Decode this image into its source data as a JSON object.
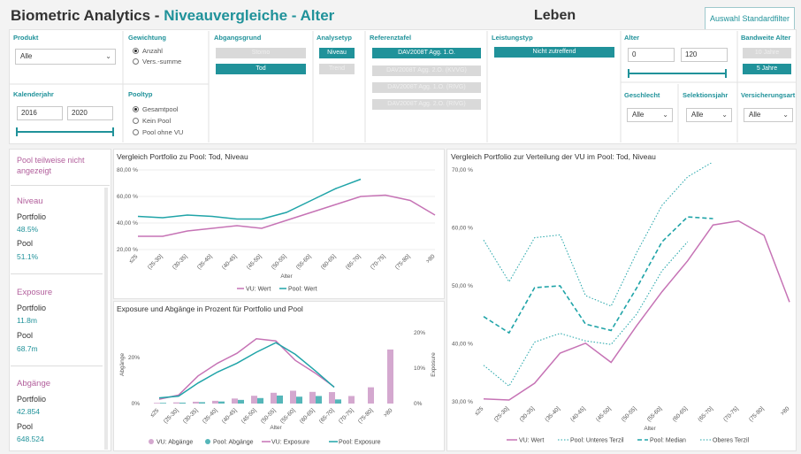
{
  "header": {
    "title_main": "Biometric Analytics - ",
    "title_accent": "Niveauvergleiche - Alter",
    "section": "Leben",
    "default_filter_button": "Auswahl Standardfilter"
  },
  "filters": {
    "produkt": {
      "label": "Produkt",
      "value": "Alle"
    },
    "gewichtung": {
      "label": "Gewichtung",
      "options": [
        "Anzahl",
        "Vers.-summe"
      ],
      "selected": "Anzahl"
    },
    "abgangsgrund": {
      "label": "Abgangsgrund",
      "buttons": [
        "Storno",
        "Tod"
      ],
      "selected": "Tod"
    },
    "analysetyp": {
      "label": "Analysetyp",
      "buttons": [
        "Niveau",
        "Trend"
      ],
      "selected": "Niveau"
    },
    "referenztafel": {
      "label": "Referenztafel",
      "buttons": [
        "DAV2008T Agg. 1.O.",
        "DAV2008T Agg. 2.O. (KVVG)",
        "DAV2008T Agg. 1.O. (RIVG)",
        "DAV2008T Agg. 2.O. (RIVG)"
      ],
      "selected": "DAV2008T Agg. 1.O."
    },
    "leistungstyp": {
      "label": "Leistungstyp",
      "buttons": [
        "Nicht zutreffend"
      ],
      "selected": "Nicht zutreffend"
    },
    "alter": {
      "label": "Alter",
      "min": "0",
      "max": "120"
    },
    "bandweite_alter": {
      "label": "Bandweite Alter",
      "buttons": [
        "10 Jahre",
        "5 Jahre"
      ],
      "selected": "5 Jahre"
    },
    "kalenderjahr": {
      "label": "Kalenderjahr",
      "from": "2016",
      "to": "2020"
    },
    "pooltyp": {
      "label": "Pooltyp",
      "options": [
        "Gesamtpool",
        "Kein Pool",
        "Pool ohne VU"
      ],
      "selected": "Gesamtpool"
    },
    "geschlecht": {
      "label": "Geschlecht",
      "value": "Alle"
    },
    "selektionsjahr": {
      "label": "Selektionsjahr",
      "value": "Alle"
    },
    "versicherungsart": {
      "label": "Versicherungsart",
      "value": "Alle"
    }
  },
  "kpi": {
    "warning": "Pool teilweise nicht angezeigt",
    "niveau": {
      "title": "Niveau",
      "portfolio_label": "Portfolio",
      "portfolio": "48.5%",
      "pool_label": "Pool",
      "pool": "51.1%"
    },
    "exposure": {
      "title": "Exposure",
      "portfolio_label": "Portfolio",
      "portfolio": "11.8m",
      "pool_label": "Pool",
      "pool": "68.7m"
    },
    "abgaenge": {
      "title": "Abgänge",
      "portfolio_label": "Portfolio",
      "portfolio": "42.854",
      "pool_label": "Pool",
      "pool": "648.524"
    }
  },
  "colors": {
    "vu": "#c673b5",
    "pool": "#20a4a8",
    "bar_vu": "#d4a8cf",
    "bar_pool": "#55b6b9",
    "accent": "#20929a"
  },
  "chart_data": [
    {
      "type": "line",
      "title": "Vergleich Portfolio zu Pool: Tod, Niveau",
      "xlabel": "Alter",
      "categories": [
        "≤25",
        "(25-30]",
        "(30-35]",
        "(35-40]",
        "(40-45]",
        "(45-50]",
        "(50-55]",
        "(55-60]",
        "(60-65]",
        "(65-70]",
        "(70-75]",
        "(75-80]",
        ">80"
      ],
      "yticks": [
        "20,00 %",
        "40,00 %",
        "60,00 %",
        "80,00 %"
      ],
      "ylim": [
        20,
        80
      ],
      "legend": [
        "VU: Wert",
        "Pool: Wert"
      ],
      "series": [
        {
          "name": "VU: Wert",
          "values": [
            30,
            30,
            34,
            36,
            38,
            36,
            42,
            48,
            54,
            60,
            61,
            57,
            46
          ]
        },
        {
          "name": "Pool: Wert",
          "values": [
            45,
            44,
            46,
            45,
            43,
            43,
            48,
            57,
            66,
            73,
            null,
            null,
            null
          ]
        }
      ]
    },
    {
      "type": "bar+line",
      "title": "Exposure und Abgänge in Prozent für Portfolio und Pool",
      "xlabel": "Alter",
      "ylabel_left": "Abgänge",
      "ylabel_right": "Exposure",
      "categories": [
        "≤25",
        "(25-30]",
        "(30-35]",
        "(35-40]",
        "(40-45]",
        "(45-50]",
        "(50-55]",
        "(55-60]",
        "(60-65]",
        "(65-70]",
        "(70-75]",
        "(75-80]",
        ">80"
      ],
      "yticks_left": [
        "0%",
        "20%"
      ],
      "yticks_right": [
        "0%",
        "10%",
        "20%"
      ],
      "legend": [
        "VU: Abgänge",
        "Pool: Abgänge",
        "VU: Exposure",
        "Pool: Exposure"
      ],
      "series": [
        {
          "name": "VU: Abgänge",
          "values": [
            0.3,
            0.5,
            0.8,
            1.2,
            2.2,
            3.4,
            4.7,
            5.6,
            5.1,
            5.0,
            3.3,
            7.1,
            23.6
          ]
        },
        {
          "name": "Pool: Abgänge",
          "values": [
            0.3,
            0.4,
            0.6,
            0.9,
            1.6,
            2.4,
            3.5,
            3.0,
            3.3,
            1.8,
            null,
            null,
            null
          ]
        },
        {
          "name": "VU: Exposure",
          "values": [
            1.2,
            2.4,
            7.8,
            11.4,
            14.2,
            18.3,
            17.7,
            12.2,
            8.7,
            4.7,
            null,
            null,
            null
          ]
        },
        {
          "name": "Pool: Exposure",
          "values": [
            1.6,
            2.1,
            5.8,
            8.9,
            11.4,
            14.5,
            17.2,
            13.9,
            9.4,
            4.6,
            null,
            null,
            null
          ]
        }
      ]
    },
    {
      "type": "line",
      "title": "Vergleich Portfolio zur Verteilung der VU im Pool: Tod, Niveau",
      "xlabel": "Alter",
      "categories": [
        "≤25",
        "(25-30]",
        "(30-35]",
        "(35-40]",
        "(40-45]",
        "(45-50]",
        "(50-55]",
        "(55-60]",
        "(60-65]",
        "(65-70]",
        "(70-75]",
        "(75-80]",
        ">80"
      ],
      "yticks": [
        "30,00 %",
        "40,00 %",
        "50,00 %",
        "60,00 %",
        "70,00 %"
      ],
      "ylim": [
        30,
        70
      ],
      "legend": [
        "VU: Wert",
        "Pool: Unteres Terzil",
        "Pool: Median",
        "Oberes Terzil"
      ],
      "series": [
        {
          "name": "VU: Wert",
          "values": [
            30.5,
            30.3,
            33.2,
            38.4,
            40.1,
            36.8,
            43.1,
            49.0,
            54.3,
            60.5,
            61.2,
            58.7,
            47.2
          ]
        },
        {
          "name": "Pool: Unteres Terzil",
          "values": [
            36.3,
            32.7,
            40.3,
            41.8,
            40.5,
            39.9,
            45.1,
            52.6,
            57.6,
            null,
            null,
            null,
            null
          ]
        },
        {
          "name": "Pool: Median",
          "values": [
            44.7,
            41.9,
            49.7,
            50.0,
            43.4,
            42.3,
            49.6,
            57.6,
            61.9,
            61.6,
            null,
            null,
            null
          ]
        },
        {
          "name": "Oberes Terzil",
          "values": [
            57.9,
            50.7,
            58.3,
            58.8,
            48.3,
            46.5,
            55.7,
            63.9,
            68.8,
            71.4,
            null,
            null,
            null
          ]
        }
      ]
    }
  ]
}
